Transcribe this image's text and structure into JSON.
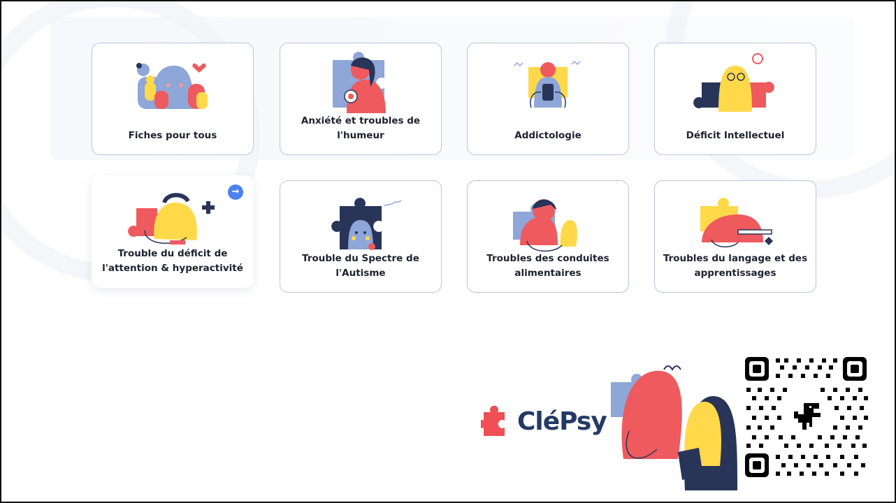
{
  "cards": [
    {
      "label": "Fiches pour tous",
      "icon": "family-illustration-icon"
    },
    {
      "label": "Anxiété et troubles de\nl'humeur",
      "icon": "anxious-person-puzzle-icon"
    },
    {
      "label": "Addictologie",
      "icon": "phone-addict-icon"
    },
    {
      "label": "Déficit Intellectuel",
      "icon": "thinking-person-puzzle-icon"
    },
    {
      "label": "Trouble du déficit de\nl'attention & hyperactivité",
      "icon": "distracted-person-icon"
    },
    {
      "label": "Trouble du Spectre de\nl'Autisme",
      "icon": "autism-puzzle-icon"
    },
    {
      "label": "Troubles des conduites\nalimentaires",
      "icon": "eating-person-icon"
    },
    {
      "label": "Troubles du langage et des\napprentissages",
      "icon": "reading-person-icon"
    }
  ],
  "active_card_arrow": "→",
  "brand": {
    "name": "CléPsy",
    "logo": "puzzle-piece-logo",
    "accent": "#ef4f55",
    "navy": "#243a66"
  },
  "qr": {
    "icon": "qr-code-dino-icon"
  },
  "colors": {
    "red": "#ef5a5e",
    "yellow": "#ffd94a",
    "blue": "#8ea6d8",
    "navy": "#283458",
    "card_border": "#b8c6dc",
    "arrow_blue": "#4d82ee"
  }
}
